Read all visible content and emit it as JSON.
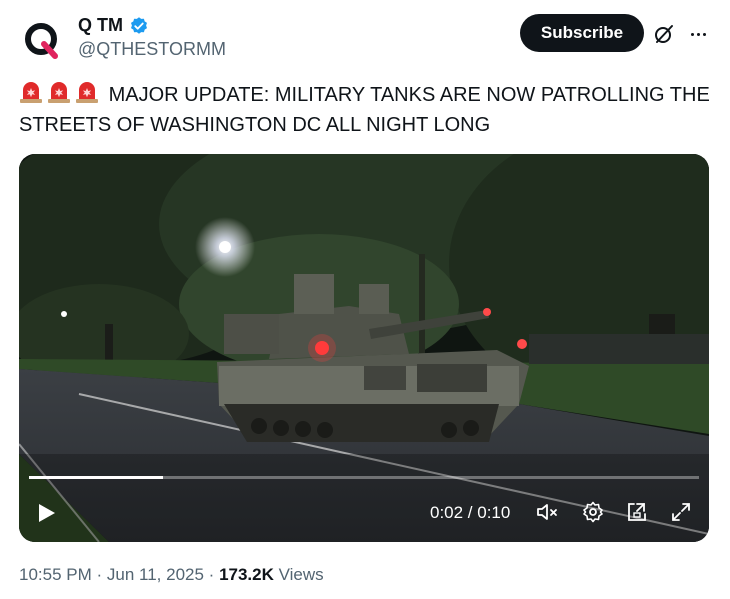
{
  "account": {
    "avatar_letter": "Q",
    "display_name": "Q TM",
    "handle": "@QTHESTORMM",
    "verified_color": "#1d9bf0"
  },
  "header": {
    "subscribe_label": "Subscribe"
  },
  "tweet": {
    "text": "MAJOR UPDATE: MILITARY TANKS ARE NOW PATROLLING THE STREETS OF WASHINGTON DC ALL NIGHT LONG",
    "siren_emoji_count": 3
  },
  "video": {
    "time_label": "0:02 / 0:10",
    "progress_fraction": 0.2
  },
  "footer": {
    "time": "10:55 PM",
    "date": "Jun 11, 2025",
    "views_count": "173.2K",
    "views_label": "Views"
  },
  "icons": [
    "verified-badge-icon",
    "grok-icon",
    "more-icon",
    "siren-emoji-icon",
    "play-icon",
    "mute-icon",
    "settings-icon",
    "picture-in-picture-icon",
    "fullscreen-icon"
  ]
}
